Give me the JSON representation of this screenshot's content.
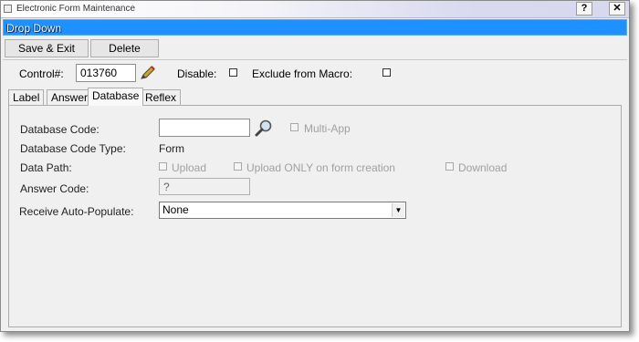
{
  "window": {
    "title": "Electronic Form Maintenance",
    "help_label": "?",
    "close_label": "✕"
  },
  "header": {
    "banner": "Drop Down"
  },
  "toolbar": {
    "save_exit_label": "Save & Exit",
    "delete_label": "Delete"
  },
  "control": {
    "label": "Control#:",
    "value": "013760",
    "disable_label": "Disable:",
    "disable_checked": false,
    "exclude_label": "Exclude from Macro:",
    "exclude_checked": false
  },
  "tabs": [
    {
      "label": "Label",
      "active": false
    },
    {
      "label": "Answer",
      "active": false
    },
    {
      "label": "Database",
      "active": true
    },
    {
      "label": "Reflex",
      "active": false
    }
  ],
  "database": {
    "code_label": "Database Code:",
    "code_value": "",
    "multi_app_label": "Multi-App",
    "code_type_label": "Database Code Type:",
    "code_type_value": "Form",
    "data_path_label": "Data Path:",
    "upload_label": "Upload",
    "upload_only_label": "Upload ONLY on form creation",
    "download_label": "Download",
    "answer_code_label": "Answer Code:",
    "answer_code_value": "?",
    "receive_label": "Receive Auto-Populate:",
    "receive_value": "None"
  }
}
